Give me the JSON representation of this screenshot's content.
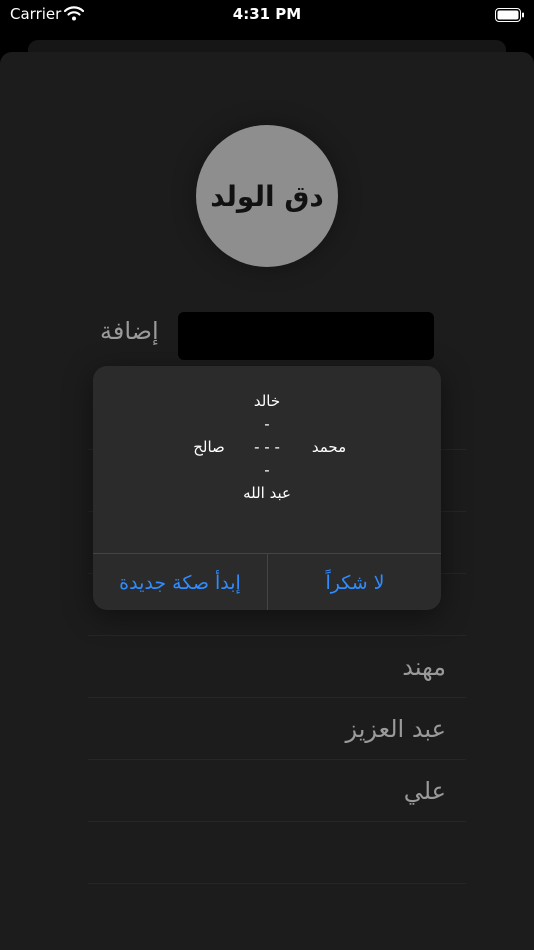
{
  "status_bar": {
    "carrier": "Carrier",
    "time": "4:31 PM"
  },
  "main": {
    "ball_label": "دق الولد",
    "add_label": "إضافة",
    "input_value": "",
    "list_items": [
      "",
      "",
      "",
      "",
      "مهند",
      "عبد العزيز",
      "علي",
      ""
    ]
  },
  "alert": {
    "top": "خالد",
    "dash_top": "-",
    "right": "محمد",
    "center": "- - -",
    "left": "صالح",
    "dash_bottom": "-",
    "bottom": "عبد الله",
    "button_new_round": "إبدأ صكة جديدة",
    "button_no_thanks": "لا شكراً"
  },
  "colors": {
    "accent": "#2f8cff",
    "ball": "#8e8e8e",
    "sheet_background": "#1c1c1c"
  }
}
